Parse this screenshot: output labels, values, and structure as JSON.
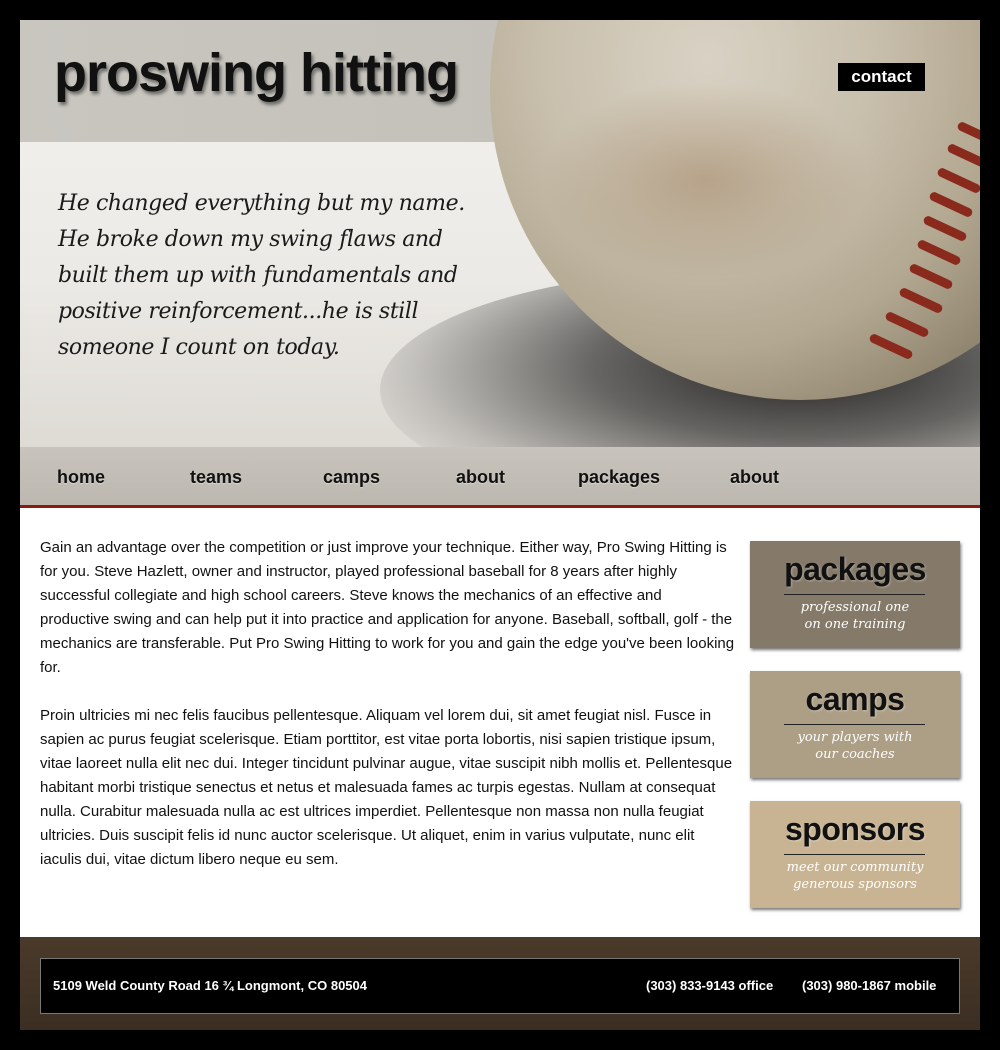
{
  "header": {
    "site_title": "proswing hitting",
    "contact_label": "contact",
    "quote": "He changed everything but my name. He broke down my swing flaws and built them up with fundamentals and positive reinforcement...he is still someone I count on today."
  },
  "nav": {
    "items": [
      {
        "label": "home"
      },
      {
        "label": "teams"
      },
      {
        "label": "camps"
      },
      {
        "label": "about"
      },
      {
        "label": "packages"
      },
      {
        "label": "about"
      }
    ]
  },
  "content": {
    "paragraph1": "Gain an advantage over the competition or just improve your technique. Either way, Pro Swing Hitting is for you. Steve Hazlett, owner and instructor, played professional baseball for 8 years after highly successful collegiate and high school careers. Steve knows the mechanics of an effective and productive swing and can help put it into practice and application for anyone. Baseball, softball, golf - the mechanics are transferable. Put Pro Swing Hitting to work for you and gain the edge you've been looking for.",
    "paragraph2": "Proin ultricies mi nec felis faucibus pellentesque. Aliquam vel lorem dui, sit amet feugiat nisl. Fusce in sapien ac purus feugiat scelerisque. Etiam porttitor, est vitae porta lobortis, nisi sapien tristique ipsum, vitae laoreet nulla elit nec dui. Integer tincidunt pulvinar augue, vitae suscipit nibh mollis et. Pellentesque habitant morbi tristique senectus et netus et malesuada fames ac turpis egestas. Nullam at consequat nulla. Curabitur malesuada nulla ac est ultrices imperdiet. Pellentesque non massa non nulla feugiat ultricies. Duis suscipit felis id nunc auctor scelerisque. Ut aliquet, enim in varius vulputate, nunc elit iaculis dui, vitae dictum libero neque eu sem."
  },
  "sidebar": {
    "promos": [
      {
        "title": "packages",
        "line1": "professional one",
        "line2": "on one training",
        "color": "#857a69"
      },
      {
        "title": "camps",
        "line1": "your players with",
        "line2": "our coaches",
        "color": "#ad9e86"
      },
      {
        "title": "sponsors",
        "line1": "meet our community",
        "line2": "generous sponsors",
        "color": "#c8b493"
      }
    ]
  },
  "footer": {
    "address": "5109 Weld County Road 16 ¾ Longmont, CO 80504",
    "office_phone": "(303) 833-9143 office",
    "mobile_phone": "(303) 980-1867 mobile"
  },
  "colors": {
    "nav_underline": "#8b1a0d",
    "footer_bg": "#3b2e22"
  }
}
